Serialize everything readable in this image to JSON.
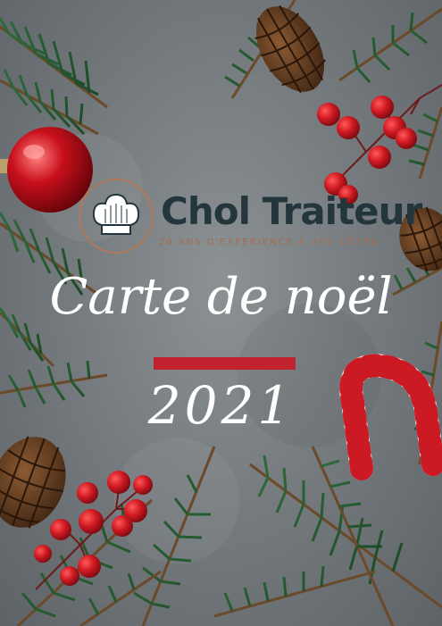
{
  "brand": {
    "name": "Chol Traiteur",
    "tagline": "20 ANS D'EXPERIENCE À VOS CÔTÉS"
  },
  "cover": {
    "title": "Carte de noël",
    "year": "2021"
  },
  "colors": {
    "background": "#7a8082",
    "brand_text": "#22363b",
    "tagline": "#a46c4c",
    "accent_bar": "#c0222e"
  },
  "icons": [
    "chef-hat-icon"
  ]
}
